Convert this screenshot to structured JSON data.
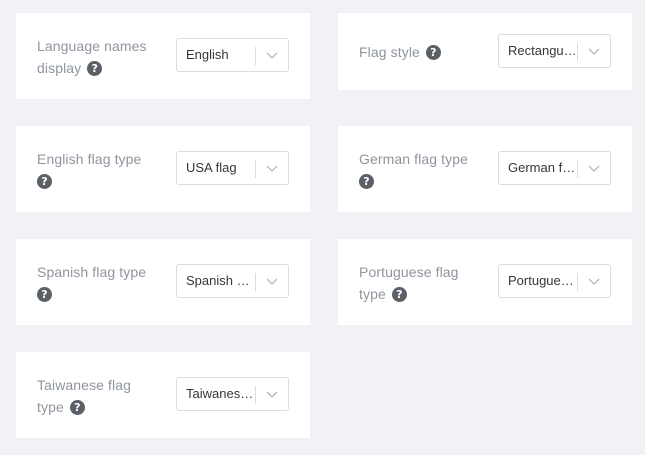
{
  "settings": [
    {
      "label_lines": [
        "Language names",
        "display"
      ],
      "value": "English",
      "help_icon": "question-circle-icon"
    },
    {
      "label_lines": [
        "Flag style"
      ],
      "value": "Rectangular",
      "help_icon": "question-circle-icon"
    },
    {
      "label_lines": [
        "English flag type"
      ],
      "value": "USA flag",
      "help_icon": "question-circle-icon"
    },
    {
      "label_lines": [
        "German flag type"
      ],
      "value": "German flag",
      "help_icon": "question-circle-icon"
    },
    {
      "label_lines": [
        "Spanish flag type"
      ],
      "value": "Spanish Flag",
      "help_icon": "question-circle-icon"
    },
    {
      "label_lines": [
        "Portuguese flag",
        "type"
      ],
      "value": "Portuguese flag",
      "help_icon": "question-circle-icon"
    },
    {
      "label_lines": [
        "Taiwanese flag",
        "type"
      ],
      "value": "Taiwanese flag",
      "help_icon": "question-circle-icon"
    }
  ],
  "colors": {
    "background": "#f1f2f6",
    "card": "#ffffff",
    "label_text": "#8f959e",
    "value_text": "#33363b",
    "help_icon": "#5b6067",
    "border": "#d9dce2"
  }
}
